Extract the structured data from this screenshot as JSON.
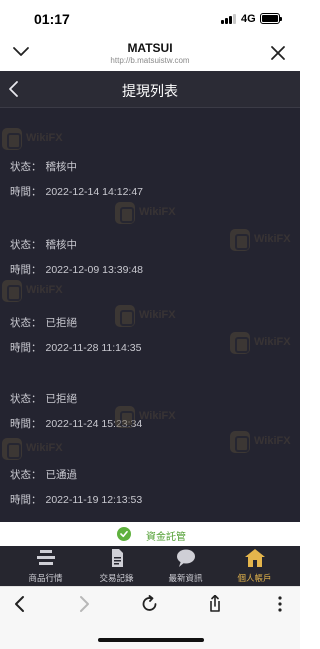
{
  "status_bar": {
    "time": "01:17",
    "network": "4G"
  },
  "browser": {
    "title": "MATSUI",
    "url": "http://b.matsuistw.com"
  },
  "page": {
    "title": "提現列表"
  },
  "records": [
    {
      "status_label": "状态：",
      "status": "稽核中",
      "time_label": "時間：",
      "time": "2022-12-14 14:12:47"
    },
    {
      "status_label": "状态：",
      "status": "稽核中",
      "time_label": "時間：",
      "time": "2022-12-09 13:39:48"
    },
    {
      "status_label": "状态：",
      "status": "已拒絕",
      "time_label": "時間：",
      "time": "2022-11-28 11:14:35"
    },
    {
      "status_label": "状态：",
      "status": "已拒絕",
      "time_label": "時間：",
      "time": "2022-11-24 15:23:34"
    },
    {
      "status_label": "状态：",
      "status": "已通過",
      "time_label": "時間：",
      "time": "2022-11-19 12:13:53"
    }
  ],
  "watermark": {
    "text": "WikiFX"
  },
  "trust": {
    "text": "資金託管"
  },
  "tabs": [
    {
      "label": "商品行情",
      "icon": "list-icon"
    },
    {
      "label": "交易記錄",
      "icon": "document-icon"
    },
    {
      "label": "最新資訊",
      "icon": "chat-icon"
    },
    {
      "label": "個人帳戶",
      "icon": "home-icon",
      "active": true
    }
  ],
  "colors": {
    "content_bg": "#242430",
    "tab_active": "#e4b54c",
    "trust_green": "#5fb13e"
  }
}
